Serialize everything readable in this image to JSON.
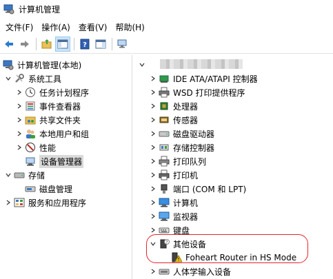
{
  "window": {
    "title": "计算机管理"
  },
  "menu": {
    "items": [
      "文件(F)",
      "操作(A)",
      "查看(V)",
      "帮助(H)"
    ]
  },
  "left_tree": {
    "root": "计算机管理(本地)",
    "system_tools": "系统工具",
    "task_scheduler": "任务计划程序",
    "event_viewer": "事件查看器",
    "shared_folders": "共享文件夹",
    "local_users": "本地用户和组",
    "performance": "性能",
    "device_manager": "设备管理器",
    "storage": "存储",
    "disk_management": "磁盘管理",
    "services": "服务和应用程序"
  },
  "right_tree": {
    "ide": "IDE ATA/ATAPI 控制器",
    "wsd": "WSD 打印提供程序",
    "processor": "处理器",
    "sensor": "传感器",
    "disk_drive": "磁盘驱动器",
    "storage_ctrl": "存储控制器",
    "print_queue": "打印队列",
    "printer": "打印机",
    "ports": "端口 (COM 和 LPT)",
    "computer": "计算机",
    "monitor": "监视器",
    "keyboard": "键盘",
    "other_devices": "其他设备",
    "foheart": "Foheart Router in HS Mode",
    "hid": "人体学输入设备"
  }
}
